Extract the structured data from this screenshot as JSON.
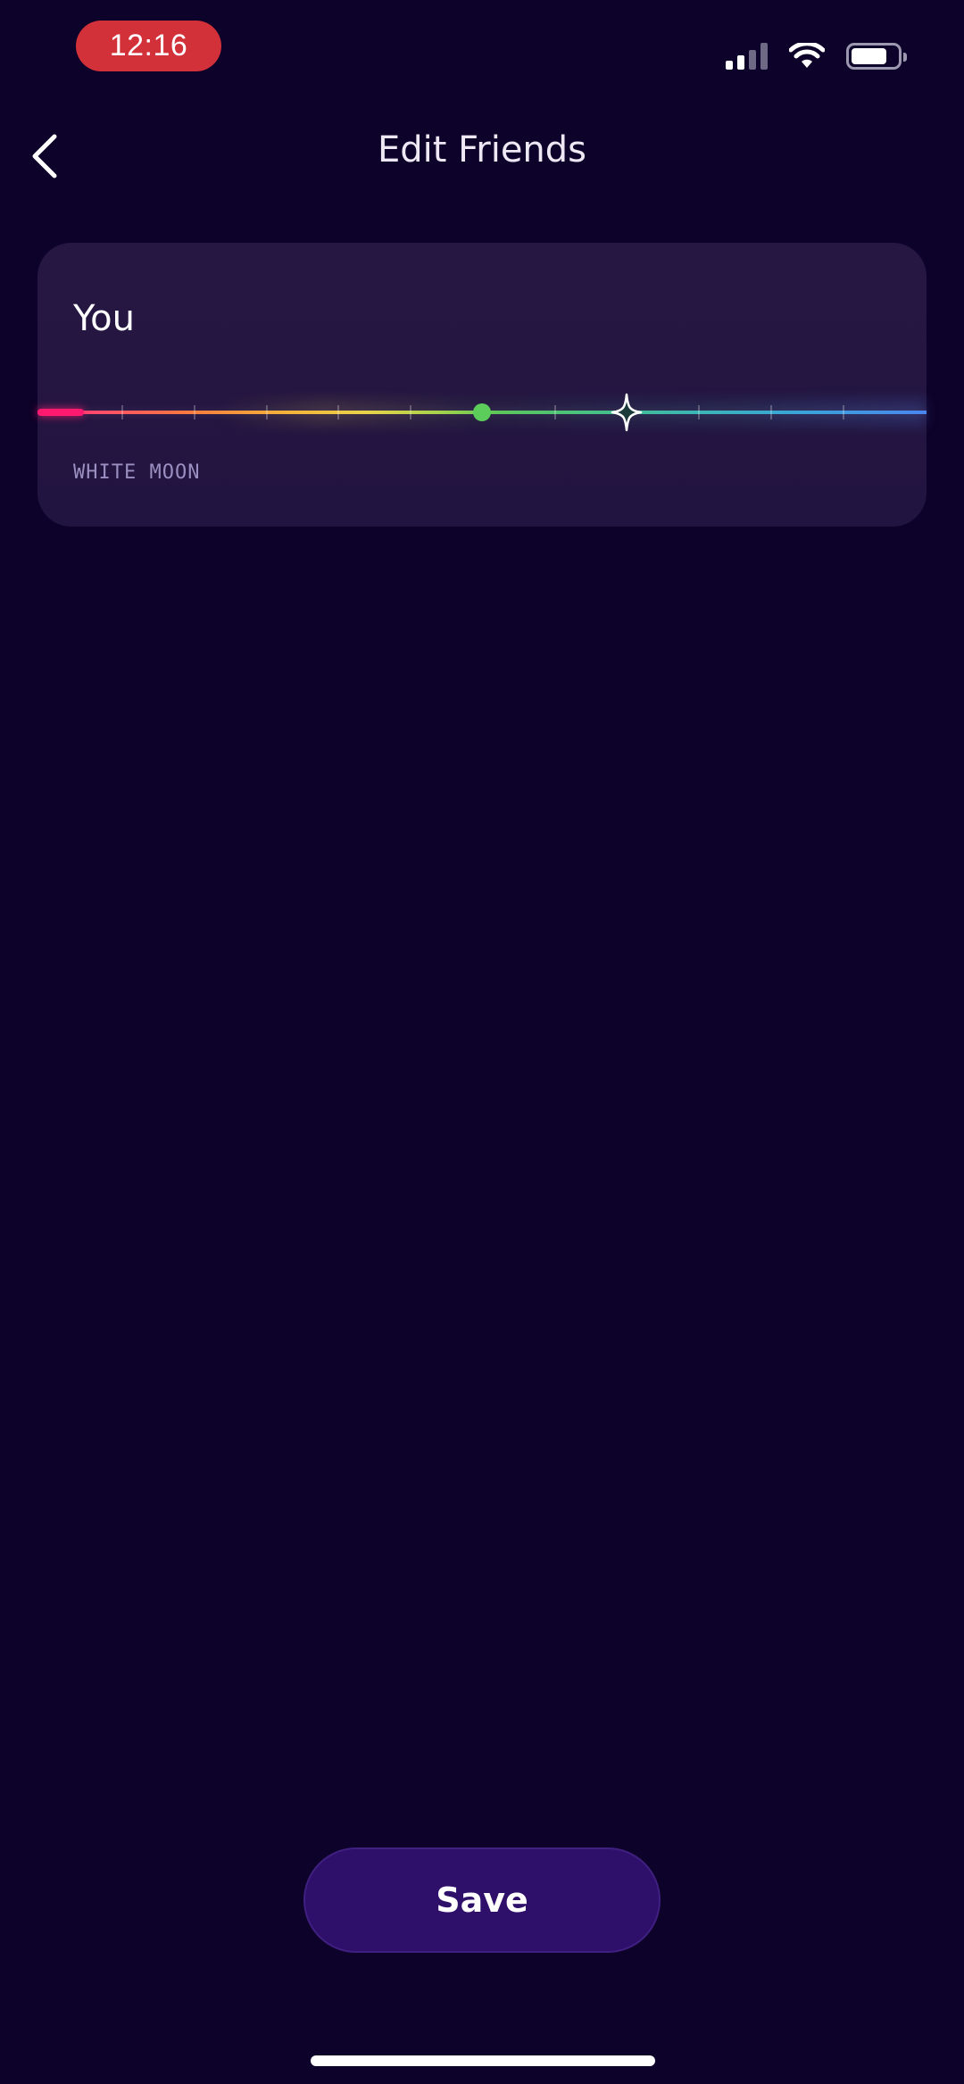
{
  "status_bar": {
    "time": "12:16",
    "time_badge_color": "#d3313a",
    "icons": [
      "cellular-signal-icon",
      "wifi-icon",
      "battery-icon"
    ]
  },
  "header": {
    "title": "Edit Friends",
    "back_icon": "chevron-left-icon"
  },
  "card": {
    "name": "You",
    "label": "WHITE MOON",
    "spectrum": {
      "colors": [
        "#ff2a7a",
        "#f97a3f",
        "#e9d34a",
        "#5bc65a",
        "#3bb6b6",
        "#4a86f0"
      ],
      "dot_color": "#5ccc5a",
      "dot_position": 0.5,
      "star_position": 0.663
    }
  },
  "footer": {
    "save_label": "Save"
  },
  "colors": {
    "background": "#0d0229",
    "card": "#251640",
    "button": "#2e0f6a"
  }
}
